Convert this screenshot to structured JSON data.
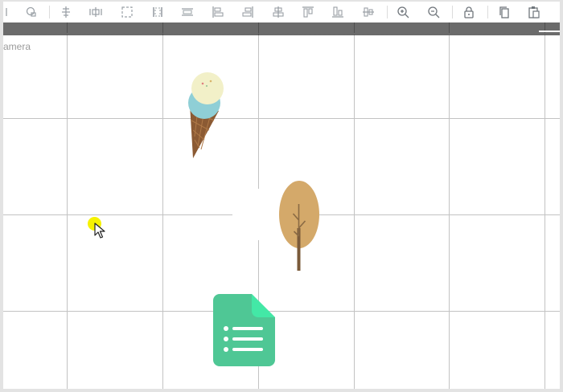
{
  "toolbar": {
    "buttons": [
      {
        "icon": "partial-icon"
      },
      {
        "icon": "edit-costume-icon"
      },
      {
        "icon": "align-horizontal-distribute-icon"
      },
      {
        "icon": "align-horizontal-center-icon"
      },
      {
        "icon": "select-bounding-icon"
      },
      {
        "icon": "resize-edges-icon"
      },
      {
        "icon": "frame-icon"
      },
      {
        "icon": "align-left-icon"
      },
      {
        "icon": "align-right-icon"
      },
      {
        "icon": "align-center-vertical-icon"
      },
      {
        "icon": "align-top-icon"
      },
      {
        "icon": "align-bottom-icon"
      },
      {
        "icon": "align-middle-icon"
      },
      {
        "icon": "zoom-in-icon"
      },
      {
        "icon": "zoom-out-icon"
      },
      {
        "icon": "lock-icon"
      },
      {
        "icon": "copy-icon"
      },
      {
        "icon": "paste-icon"
      }
    ]
  },
  "stage": {
    "camera_label": "amera"
  },
  "sprites": [
    {
      "name": "ice-cream",
      "icon": "ice-cream-icon"
    },
    {
      "name": "tree",
      "icon": "tree-icon"
    },
    {
      "name": "document",
      "icon": "document-icon"
    }
  ],
  "colors": {
    "toolbar_icon": "#9aa0a6",
    "ruler": "#6b6b6b",
    "grid": "#c3c3c3",
    "cursor_highlight": "#f6f200",
    "tree_crown": "#d4a96a",
    "document": "#4fc795",
    "ice_cream_top": "#f2f0c8",
    "ice_cream_mid": "#8fcfd6",
    "ice_cream_cone": "#8b5a33"
  }
}
